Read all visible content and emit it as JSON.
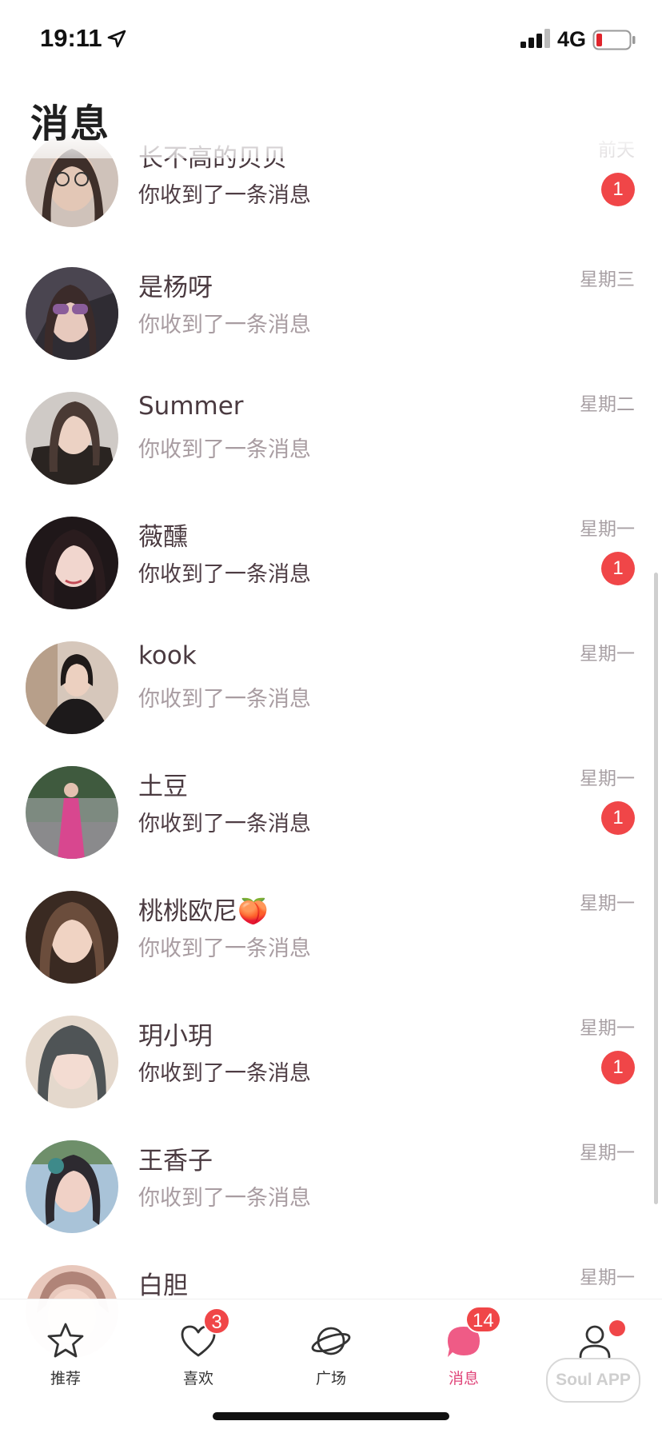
{
  "status_bar": {
    "time": "19:11",
    "network": "4G"
  },
  "header": {
    "title": "消息"
  },
  "messages": [
    {
      "name": "长不高的贝贝",
      "preview": "你收到了一条消息",
      "time": "前天",
      "unread": "1",
      "read": false,
      "avatar_color": "#8c7468"
    },
    {
      "name": "是杨呀",
      "preview": "你收到了一条消息",
      "time": "星期三",
      "unread": "",
      "read": true,
      "avatar_color": "#5d4e5a"
    },
    {
      "name": "Summer",
      "preview": "你收到了一条消息",
      "time": "星期二",
      "unread": "",
      "read": true,
      "avatar_color": "#6e6158"
    },
    {
      "name": "薇醺",
      "preview": "你收到了一条消息",
      "time": "星期一",
      "unread": "1",
      "read": false,
      "avatar_color": "#3a2b2e"
    },
    {
      "name": "kook",
      "preview": "你收到了一条消息",
      "time": "星期一",
      "unread": "",
      "read": true,
      "avatar_color": "#a08a7e"
    },
    {
      "name": "土豆",
      "preview": "你收到了一条消息",
      "time": "星期一",
      "unread": "1",
      "read": false,
      "avatar_color": "#7d6c74"
    },
    {
      "name": "桃桃欧尼🍑",
      "preview": "你收到了一条消息",
      "time": "星期一",
      "unread": "",
      "read": true,
      "avatar_color": "#5c4236"
    },
    {
      "name": "玥小玥",
      "preview": "你收到了一条消息",
      "time": "星期一",
      "unread": "1",
      "read": false,
      "avatar_color": "#7a8082"
    },
    {
      "name": "王香子",
      "preview": "你收到了一条消息",
      "time": "星期一",
      "unread": "",
      "read": true,
      "avatar_color": "#9aa9b6"
    },
    {
      "name": "白胆",
      "preview": "",
      "time": "星期一",
      "unread": "",
      "read": true,
      "avatar_color": "#c49686"
    }
  ],
  "tabbar": {
    "tabs": [
      {
        "label": "推荐",
        "icon": "star-icon",
        "badge": ""
      },
      {
        "label": "喜欢",
        "icon": "heart-icon",
        "badge": "3"
      },
      {
        "label": "广场",
        "icon": "planet-icon",
        "badge": ""
      },
      {
        "label": "消息",
        "icon": "chat-bubble-icon",
        "badge": "14"
      },
      {
        "label": "",
        "icon": "profile-icon",
        "badge": ""
      }
    ],
    "active_color": "#e0467a",
    "badge_color": "#f04648"
  },
  "watermark": "Soul APP"
}
